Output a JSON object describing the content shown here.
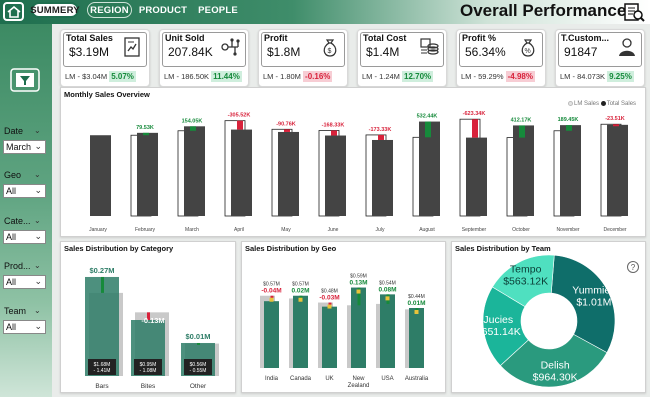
{
  "header": {
    "tabs": [
      {
        "label": "SUMMERY",
        "active": true
      },
      {
        "label": "REGION"
      },
      {
        "label": "PRODUCT"
      },
      {
        "label": "PEOPLE"
      }
    ],
    "title": "Overall Performance",
    "icons": {
      "home": "home-icon",
      "report": "report-search-icon"
    }
  },
  "filters": [
    {
      "label": "Date",
      "value": "March"
    },
    {
      "label": "Geo",
      "value": "All"
    },
    {
      "label": "Cate...",
      "value": "All"
    },
    {
      "label": "Prod...",
      "value": "All"
    },
    {
      "label": "Team",
      "value": "All"
    }
  ],
  "kpis": [
    {
      "name": "Total Sales",
      "value": "$3.19M",
      "lm": "LM - $3.04M",
      "change": "5.07%",
      "trend": "up",
      "icon": "invoice-chart-icon"
    },
    {
      "name": "Unit Sold",
      "value": "207.84K",
      "lm": "LM - 186.50K",
      "change": "11.44%",
      "trend": "up",
      "icon": "network-nodes-icon"
    },
    {
      "name": "Profit",
      "value": "$1.8M",
      "lm": "LM - 1.80M",
      "change": "-0.16%",
      "trend": "down",
      "icon": "money-bag-icon"
    },
    {
      "name": "Total Cost",
      "value": "$1.4M",
      "lm": "LM - 1.24M",
      "change": "12.70%",
      "trend": "up",
      "icon": "coin-stack-icon"
    },
    {
      "name": "Profit %",
      "value": "56.34%",
      "lm": "LM - 59.29%",
      "change": "-4.98%",
      "trend": "down",
      "icon": "money-bag-percent-icon"
    },
    {
      "name": "T.Custom...",
      "value": "91847",
      "lm": "LM - 84.073K",
      "change": "9.25%",
      "trend": "up",
      "icon": "customer-icon"
    }
  ],
  "colors": {
    "bar": "#444444",
    "teal": "#2e7d67",
    "up": "#168a3b",
    "down": "#d8223b",
    "accent": "#1e6e4e"
  },
  "monthly": {
    "title": "Monthly Sales Overview",
    "legend": [
      "LM Sales",
      "Total Sales"
    ],
    "chart_data": {
      "type": "bar",
      "categories": [
        "January",
        "February",
        "March",
        "April",
        "May",
        "June",
        "July",
        "August",
        "September",
        "October",
        "November",
        "December"
      ],
      "labels": [
        "",
        "79.53K",
        "154.05K",
        "-305.52K",
        "-90.76K",
        "-168.33K",
        "-173.33K",
        "532.44K",
        "-623.34K",
        "412.17K",
        "189.45K",
        "-23.51K"
      ],
      "series": [
        {
          "name": "LM Sales",
          "values": [
            null,
            2.72,
            2.87,
            3.21,
            2.92,
            2.88,
            2.73,
            2.65,
            3.26,
            2.64,
            2.87,
            3.09
          ]
        },
        {
          "name": "Total Sales",
          "values": [
            2.72,
            2.8,
            3.02,
            2.91,
            2.83,
            2.71,
            2.56,
            3.18,
            2.64,
            3.05,
            3.06,
            3.07
          ]
        }
      ]
    }
  },
  "category": {
    "title": "Sales Distribution by Category",
    "chart_data": {
      "type": "bar",
      "categories": [
        "Bars",
        "Bites",
        "Other"
      ],
      "change_labels": [
        "$0.27M",
        "-0.13M",
        "$0.01M"
      ],
      "box_labels": [
        [
          "$1.68M",
          "- 1.41M"
        ],
        [
          "$0.95M",
          "- 1.08M"
        ],
        [
          "$0.56M",
          "- 0.55M"
        ]
      ],
      "series": [
        {
          "name": "LM Sales",
          "values": [
            1.41,
            1.08,
            0.55
          ]
        },
        {
          "name": "Total Sales",
          "values": [
            1.68,
            0.95,
            0.56
          ]
        }
      ]
    }
  },
  "geo": {
    "title": "Sales Distribution by Geo",
    "chart_data": {
      "type": "bar",
      "categories": [
        "India",
        "Canada",
        "UK",
        "New Zealand",
        "USA",
        "Australia"
      ],
      "top_labels": [
        "$0.57M",
        "$0.57M",
        "$0.48M",
        "$0.59M",
        "$0.54M",
        "$0.44M"
      ],
      "change_labels": [
        "-0.04M",
        "0.02M",
        "-0.03M",
        "0.13M",
        "0.08M",
        "0.01M"
      ],
      "series": [
        {
          "name": "LM Sales",
          "values": [
            0.53,
            0.51,
            0.48,
            0.46,
            0.47,
            0.43
          ]
        },
        {
          "name": "Total Sales",
          "values": [
            0.49,
            0.53,
            0.45,
            0.59,
            0.54,
            0.44
          ]
        }
      ]
    }
  },
  "team": {
    "title": "Sales Distribution by Team",
    "chart_data": {
      "type": "pie",
      "slices": [
        {
          "label": "Yummies",
          "value": 1.01,
          "display": "$1.01M",
          "color": "#0f6e6a"
        },
        {
          "label": "Delish",
          "value": 0.9643,
          "display": "$964.30K",
          "color": "#2a9a7e"
        },
        {
          "label": "Jucies",
          "value": 0.65114,
          "display": "$651.14K",
          "color": "#1bb59a"
        },
        {
          "label": "Tempo",
          "value": 0.56312,
          "display": "$563.12K",
          "color": "#4fe0c0"
        }
      ]
    }
  }
}
